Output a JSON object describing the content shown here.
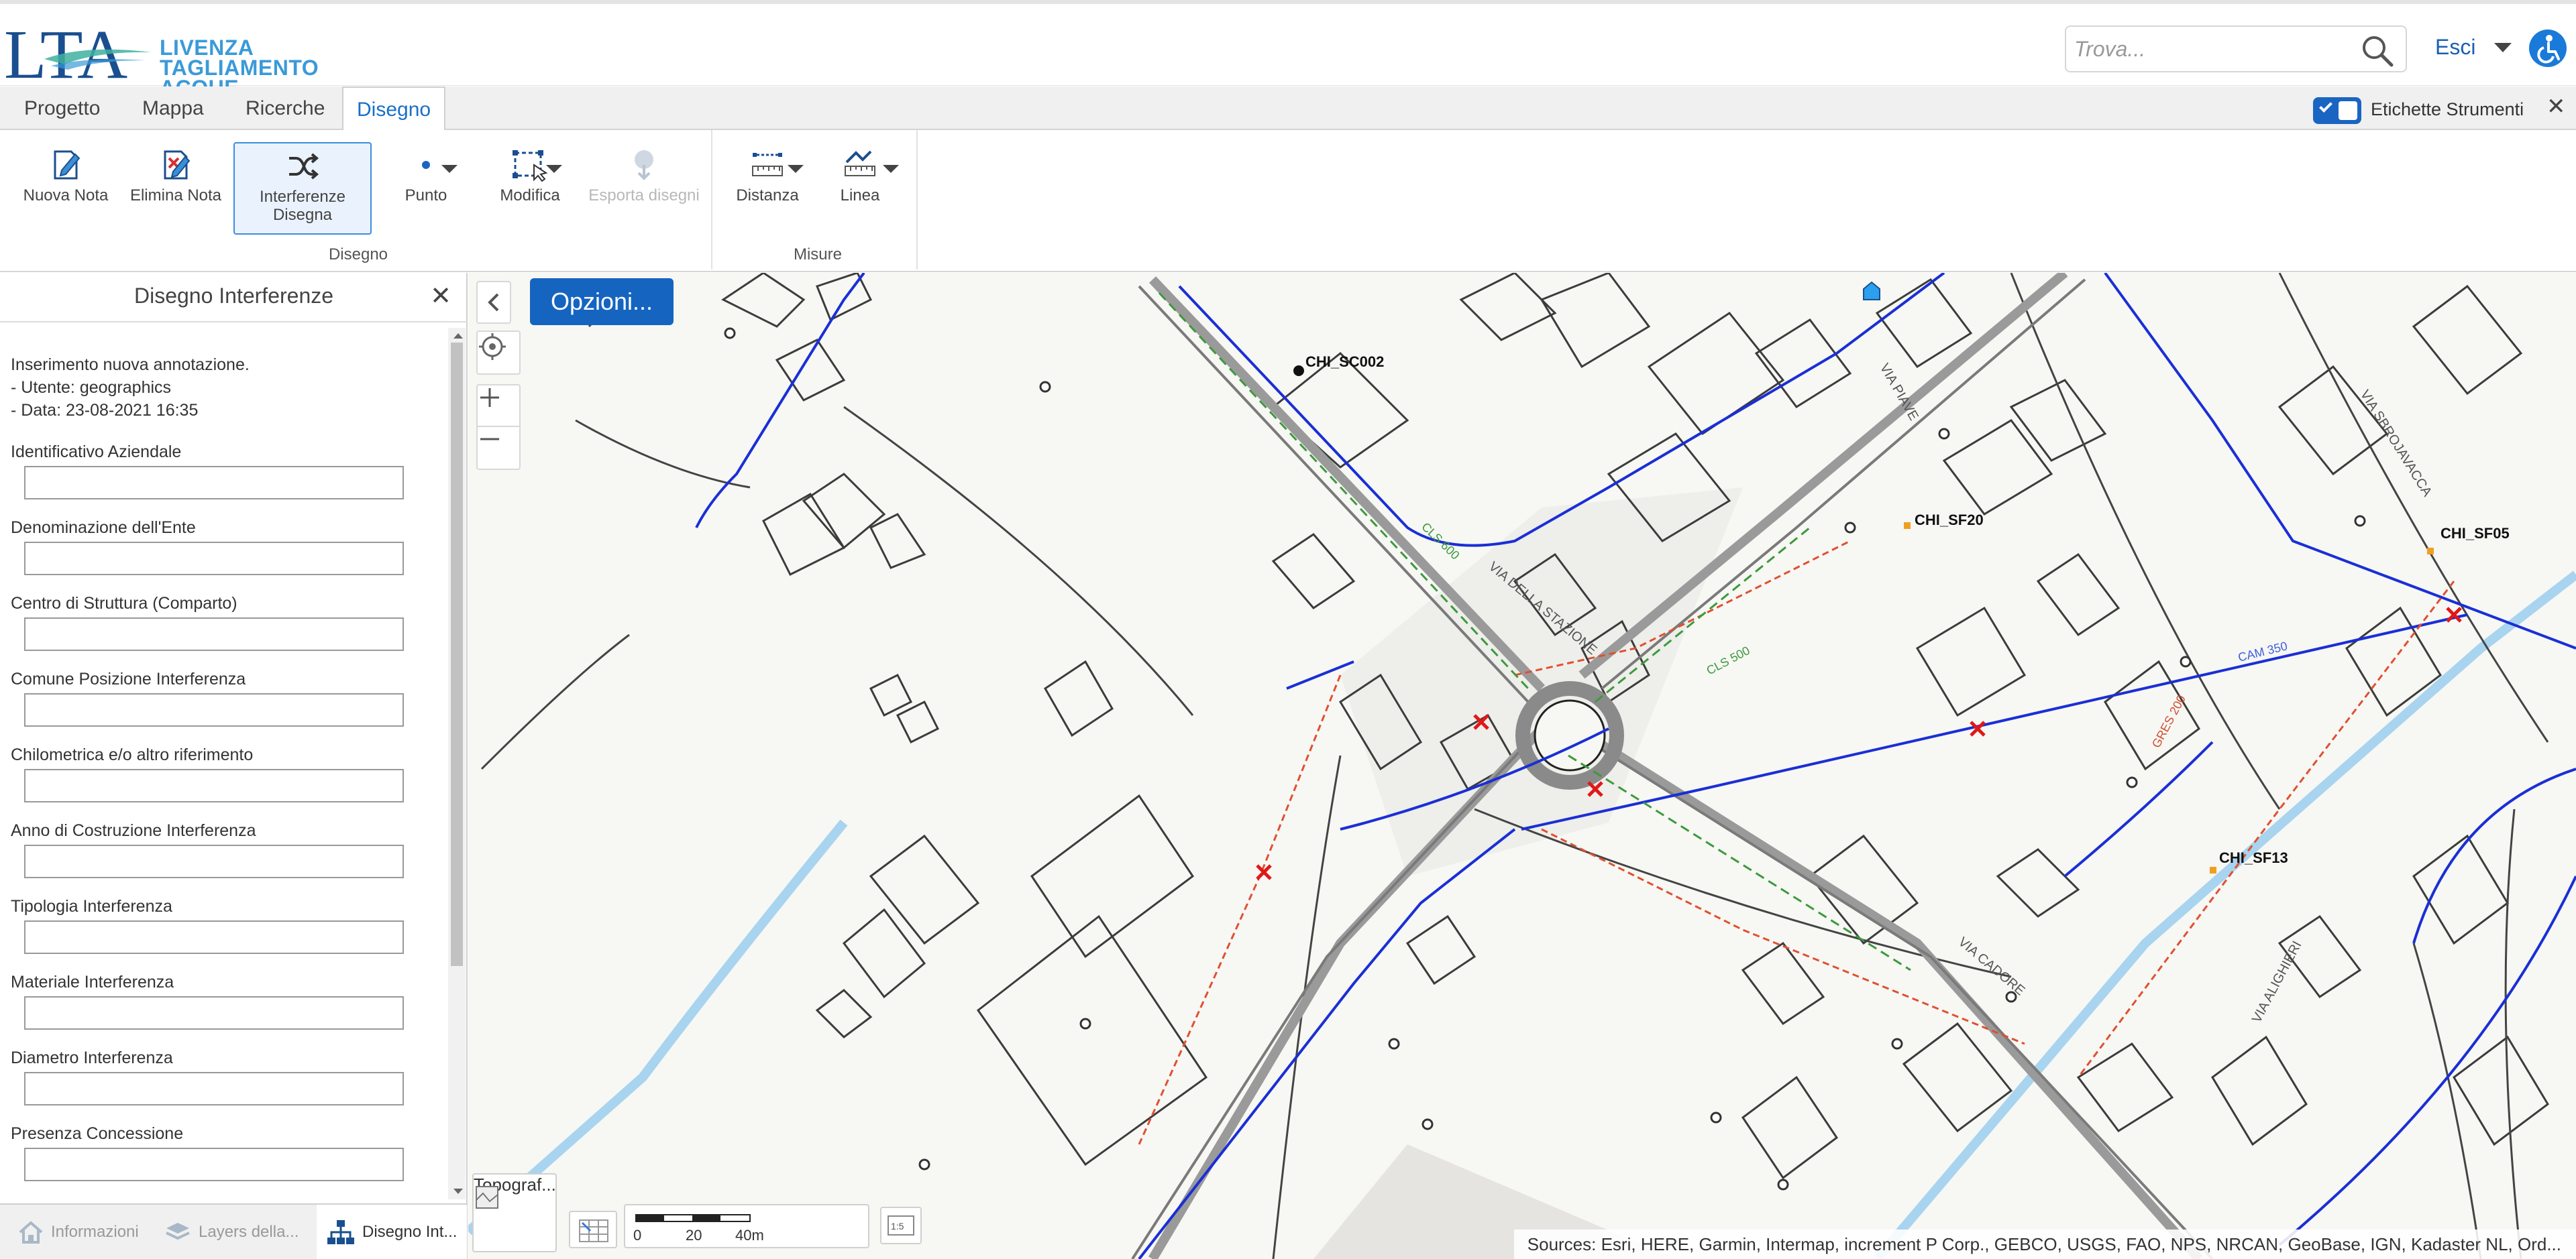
{
  "header": {
    "logo_text": "LTA",
    "logo_lines": [
      "LIVENZA",
      "TAGLIAMENTO",
      "ACQUE"
    ],
    "search_placeholder": "Trova...",
    "user_label": "Esci"
  },
  "tabs": [
    {
      "label": "Progetto",
      "active": false
    },
    {
      "label": "Mappa",
      "active": false
    },
    {
      "label": "Ricerche",
      "active": false
    },
    {
      "label": "Disegno",
      "active": true
    }
  ],
  "toolbar": {
    "labels_toggle_text": "Etichette Strumenti",
    "labels_toggle_on": true
  },
  "ribbon": {
    "groups": [
      {
        "label": "Disegno",
        "buttons": [
          {
            "label": "Nuova Nota"
          },
          {
            "label": "Elimina Nota"
          },
          {
            "label": "Interferenze Disegna",
            "line1": "Interferenze",
            "line2": "Disegna",
            "selected": true
          },
          {
            "label": "Punto"
          },
          {
            "label": "Modifica"
          },
          {
            "label": "Esporta disegni",
            "disabled": true
          }
        ]
      },
      {
        "label": "Misure",
        "buttons": [
          {
            "label": "Distanza"
          },
          {
            "label": "Linea"
          }
        ]
      }
    ]
  },
  "panel": {
    "title": "Disegno Interferenze",
    "info": {
      "line1": "Inserimento nuova annotazione.",
      "line2": "- Utente: geographics",
      "line3": "- Data: 23-08-2021 16:35"
    },
    "fields": [
      {
        "label": "Identificativo Aziendale",
        "value": ""
      },
      {
        "label": "Denominazione dell'Ente",
        "value": ""
      },
      {
        "label": "Centro di Struttura (Comparto)",
        "value": ""
      },
      {
        "label": "Comune Posizione Interferenza",
        "value": ""
      },
      {
        "label": "Chilometrica e/o altro riferimento",
        "value": ""
      },
      {
        "label": "Anno di Costruzione Interferenza",
        "value": ""
      },
      {
        "label": "Tipologia Interferenza",
        "value": ""
      },
      {
        "label": "Materiale Interferenza",
        "value": ""
      },
      {
        "label": "Diametro Interferenza",
        "value": ""
      },
      {
        "label": "Presenza Concessione",
        "value": ""
      }
    ]
  },
  "footer_tabs": [
    {
      "label": "Informazioni",
      "icon": "home-icon",
      "active": false
    },
    {
      "label": "Layers della...",
      "icon": "layers-icon",
      "active": false
    },
    {
      "label": "Disegno Int...",
      "icon": "sitemap-icon",
      "active": true
    }
  ],
  "map": {
    "options_label": "Opzioni...",
    "basemap_label": "Topograf...",
    "scale_labels": [
      "0",
      "20",
      "40m"
    ],
    "attribution": "Sources: Esri, HERE, Garmin, Intermap, increment P Corp., GEBCO, USGS, FAO, NPS, NRCAN, GeoBase, IGN, Kadaster NL, Ord...",
    "labels": [
      "CHI_SC002",
      "CHI_SF20",
      "CHI_SF05",
      "CHI_SF13",
      "VIA DELLA STAZIONE",
      "VIA SBROJAVACCA",
      "VIA CADORE",
      "VIA ALIGHIERI",
      "CAM 350",
      "GRES 200",
      "CLS 500",
      "CLS 600",
      "VIA PIAVE"
    ]
  },
  "colors": {
    "accent": "#1a6fc6",
    "options_button": "#1565c0",
    "logo_blue": "#1a4f8f",
    "logo_light": "#3a9ad9",
    "network_blue": "#1a2fd6",
    "river": "#a8d4ef",
    "sewer_red": "#e05030"
  }
}
